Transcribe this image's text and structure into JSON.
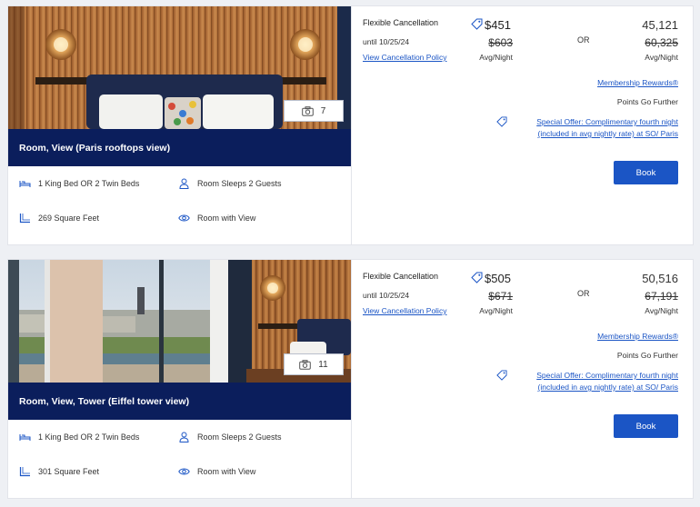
{
  "rooms": [
    {
      "name": "Room, View (Paris rooftops view)",
      "photo_count": "7",
      "beds": "1 King Bed OR 2 Twin Beds",
      "sleeps": "Room Sleeps 2 Guests",
      "size": "269 Square Feet",
      "view": "Room with View",
      "rate": {
        "title": "Flexible Cancellation",
        "until": "until 10/25/24",
        "policy_link": "View Cancellation Policy",
        "price": "$451",
        "original_price": "$603",
        "price_unit": "Avg/Night",
        "or_label": "OR",
        "points": "45,121",
        "original_points": "60,325",
        "points_unit": "Avg/Night",
        "membership_link": "Membership Rewards®",
        "points_tagline": "Points Go Further",
        "offer_link": "Special Offer: Complimentary fourth night (included in avg nightly rate) at SO/ Paris",
        "book_label": "Book"
      }
    },
    {
      "name": "Room, View, Tower (Eiffel tower view)",
      "photo_count": "11",
      "beds": "1 King Bed OR 2 Twin Beds",
      "sleeps": "Room Sleeps 2 Guests",
      "size": "301 Square Feet",
      "view": "Room with View",
      "rate": {
        "title": "Flexible Cancellation",
        "until": "until 10/25/24",
        "policy_link": "View Cancellation Policy",
        "price": "$505",
        "original_price": "$671",
        "price_unit": "Avg/Night",
        "or_label": "OR",
        "points": "50,516",
        "original_points": "67,191",
        "points_unit": "Avg/Night",
        "membership_link": "Membership Rewards®",
        "points_tagline": "Points Go Further",
        "offer_link": "Special Offer: Complimentary fourth night (included in avg nightly rate) at SO/ Paris",
        "book_label": "Book"
      }
    }
  ],
  "icons": {
    "bed": "bed-icon",
    "guests": "person-icon",
    "size": "square-feet-icon",
    "view": "eye-icon",
    "camera": "camera-icon",
    "tag": "price-tag-icon"
  },
  "colors": {
    "name_bar": "#0b1e5c",
    "link": "#1b55c5",
    "book_button": "#1b55c5"
  }
}
